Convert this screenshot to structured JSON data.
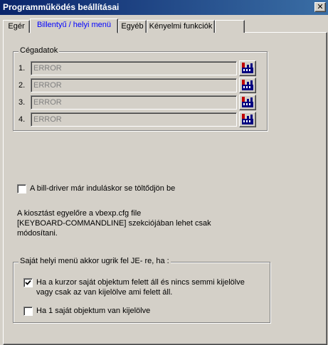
{
  "window": {
    "title": "Programműködés beállításai",
    "close_label": "✕"
  },
  "tabs": [
    {
      "label": "Egér",
      "active": false
    },
    {
      "label": "Billentyű / helyi menü",
      "active": true
    },
    {
      "label": "Egyéb",
      "active": false
    },
    {
      "label": "Kényelmi funkciók",
      "active": false
    },
    {
      "label": "",
      "active": false
    }
  ],
  "company_group": {
    "label": "Cégadatok",
    "rows": [
      {
        "number": "1.",
        "value": "ERROR"
      },
      {
        "number": "2.",
        "value": "ERROR"
      },
      {
        "number": "3.",
        "value": "ERROR"
      },
      {
        "number": "4.",
        "value": "ERROR"
      }
    ]
  },
  "bill_driver": {
    "label": "A bill-driver már induláskor se töltődjön be",
    "checked": false
  },
  "info_text": {
    "line1": "A kiosztást egyelőre a vbexp.cfg file",
    "line2": "[KEYBOARD-COMMANDLINE] szekciójában lehet csak",
    "line3": "módosítani."
  },
  "local_menu_group": {
    "label": "Saját helyi menü akkor ugrik fel  JE- re, ha :",
    "options": [
      {
        "line1": "Ha a kurzor saját objektum felett áll és nincs semmi kijelölve",
        "line2": "vagy csak az van kijelölve ami felett áll.",
        "checked": true
      },
      {
        "line1": "Ha 1 saját objektum van kijelölve",
        "line2": "",
        "checked": false
      }
    ]
  },
  "colors": {
    "titlebar_start": "#0a246a",
    "titlebar_end": "#3a6ea5",
    "active_tab_text": "#0000ff",
    "disabled_text": "#808080"
  }
}
